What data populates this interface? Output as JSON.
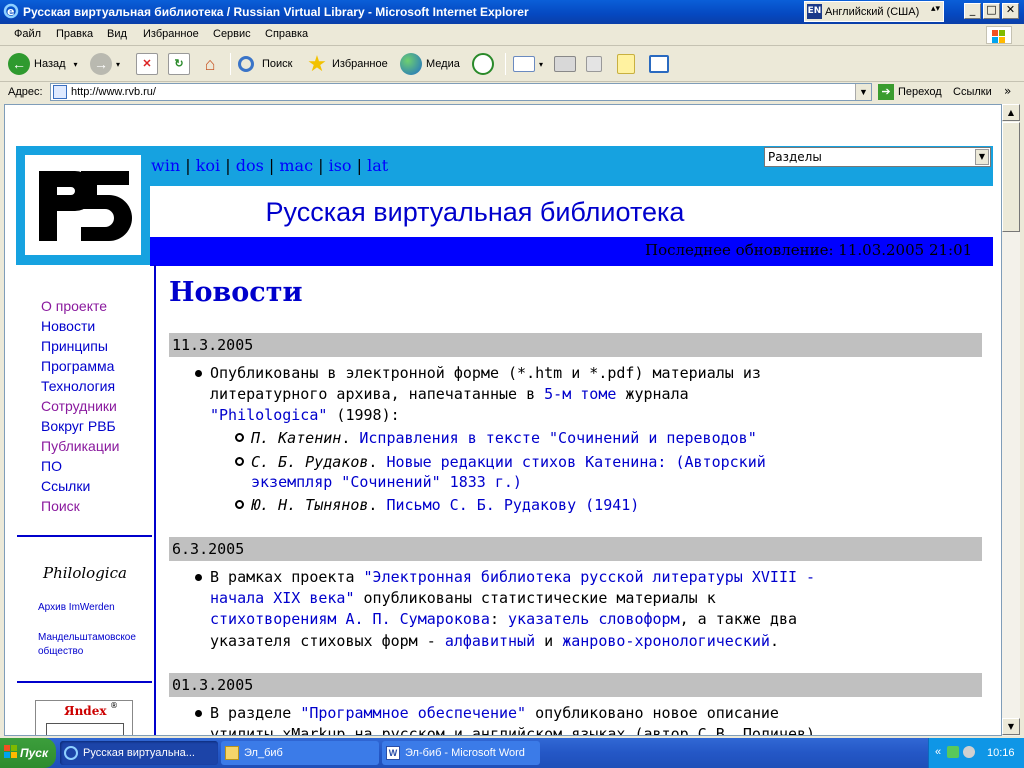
{
  "window": {
    "title": "Русская виртуальная библиотека / Russian Virtual Library - Microsoft Internet Explorer",
    "lang_indicator": "EN",
    "lang_label": "Английский (США)"
  },
  "menu": [
    "Файл",
    "Правка",
    "Вид",
    "Избранное",
    "Сервис",
    "Справка"
  ],
  "toolbar": {
    "back": "Назад",
    "search": "Поиск",
    "favorites": "Избранное",
    "media": "Медиа"
  },
  "address": {
    "label": "Адрес:",
    "url": "http://www.rvb.ru/",
    "go": "Переход",
    "links": "Ссылки"
  },
  "page": {
    "logo_text": "РБ",
    "encodings": [
      "win",
      "koi",
      "dos",
      "mac",
      "iso",
      "lat"
    ],
    "sections_select": "Разделы",
    "site_title": "Русская виртуальная библиотека",
    "last_update": "Последнее обновление: 11.03.2005 21:01",
    "nav": [
      {
        "label": "О проекте",
        "visited": true
      },
      {
        "label": "Новости",
        "visited": false
      },
      {
        "label": "Принципы",
        "visited": false
      },
      {
        "label": "Программа",
        "visited": false
      },
      {
        "label": "Технология",
        "visited": false
      },
      {
        "label": "Сотрудники",
        "visited": true
      },
      {
        "label": "Вокруг РВБ",
        "visited": false
      },
      {
        "label": "Публикации",
        "visited": true
      },
      {
        "label": "ПО",
        "visited": false
      },
      {
        "label": "Ссылки",
        "visited": false
      },
      {
        "label": "Поиск",
        "visited": true
      }
    ],
    "philologica": "Philologica",
    "partner_1": "Архив ImWerden",
    "partner_2a": "Мандельштамовское",
    "partner_2b": "общество",
    "yandex": "Яndex",
    "news_heading": "Новости",
    "news": [
      {
        "date": "11.3.2005",
        "l1": "Опубликованы в электронной форме (*.htm и *.pdf) материалы из",
        "l2a": "литературного архива, напечатанные в ",
        "l2link": "5-м томе",
        "l2b": " журнала",
        "l3link": "\"Philologica\"",
        "l3b": " (1998):",
        "s1_author": "П. Катенин",
        "s1_link": "Исправления в тексте \"Сочинений и переводов\"",
        "s2_author": "С. Б. Рудаков",
        "s2_link1": "Новые редакции стихов Катенина: (Авторский",
        "s2_link2": "экземпляр \"Сочинений\" 1833 г.)",
        "s3_author": "Ю. Н. Тынянов",
        "s3_link": "Письмо С. Б. Рудакову (1941)"
      },
      {
        "date": "6.3.2005",
        "l1a": "В рамках проекта ",
        "l1link": "\"Электронная библиотека русской литературы XVIII -",
        "l2link": "начала XIX века\"",
        "l2b": " опубликованы статистические материалы к",
        "l3link": "стихотворениям А. П. Сумарокова",
        "l3b": ": ",
        "l3link2": "указатель словоформ",
        "l3c": ", а также два",
        "l4a": "указателя стиховых форм - ",
        "l4link": "алфавитный",
        "l4b": " и ",
        "l4link2": "жанрово-хронологический",
        "l4c": "."
      },
      {
        "date": "01.3.2005",
        "l1a": "В разделе ",
        "l1link": "\"Программное обеспечение\"",
        "l1b": " опубликовано новое описание",
        "l2": "утилиты xMarkup на русском и английском языках (автор С.В. Поличев)"
      }
    ]
  },
  "taskbar": {
    "start": "Пуск",
    "tasks": [
      "Русская виртуальна...",
      "Эл_биб",
      "Эл-биб - Microsoft Word"
    ],
    "clock": "10:16"
  }
}
